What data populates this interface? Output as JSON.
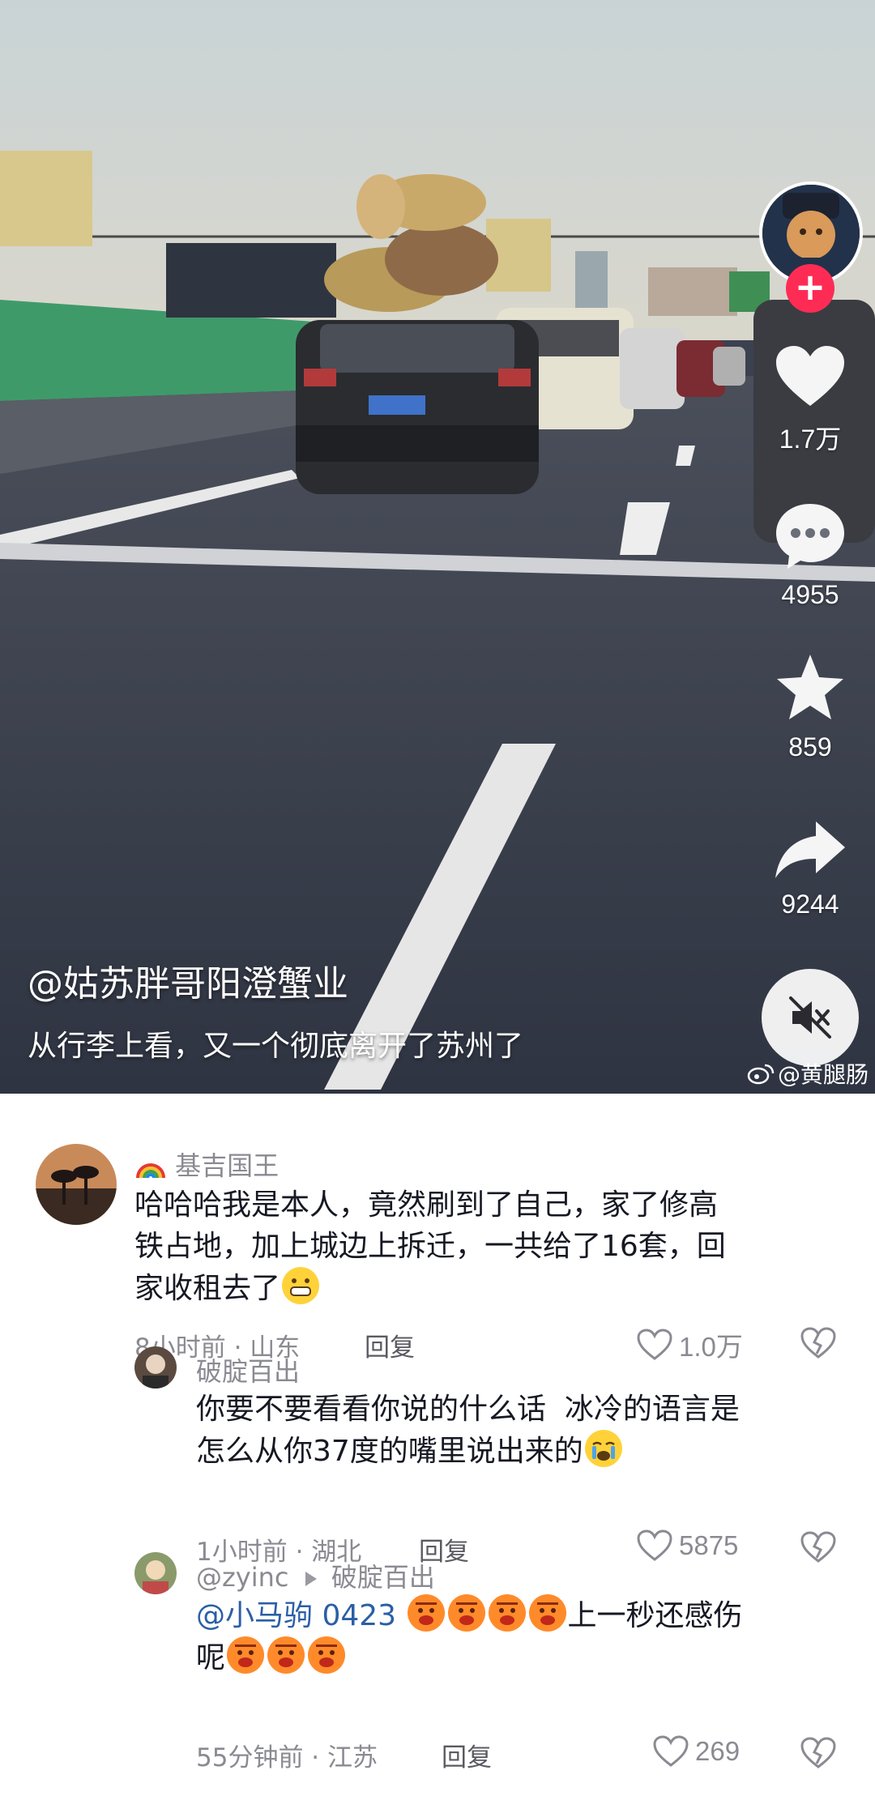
{
  "video": {
    "author_handle": "@姑苏胖哥阳澄蟹业",
    "caption": "从行李上看，又一个彻底离开了苏州了",
    "watermark": "@黄腿肠",
    "actions": {
      "like_count": "1.7万",
      "comment_count": "4955",
      "favorite_count": "859",
      "share_count": "9244"
    },
    "follow_label": "+"
  },
  "comments": [
    {
      "name": "基吉国王",
      "text": "哈哈哈我是本人，竟然刷到了自己，家了修高铁占地，加上城边上拆迁，一共给了16套，回家收租去了",
      "lines": [
        "哈哈哈我是本人，竟然刷到了自己，家了修高",
        "铁占地，加上城边上拆迁，一共给了16套，回",
        "家收租去了"
      ],
      "time_location": "8小时前 · 山东",
      "reply_label": "回复",
      "likes": "1.0万"
    },
    {
      "name": "破腚百出",
      "lines": [
        "你要不要看看你说的什么话  冰冷的语言是",
        "怎么从你37度的嘴里说出来的"
      ],
      "time_location": "1小时前 · 湖北",
      "reply_label": "回复",
      "likes": "5875"
    },
    {
      "name": "@zyinc",
      "reply_to": "破腚百出",
      "mention": "@小马驹 0423",
      "line1_tail": "上一秒还感伤",
      "line2_head": "呢",
      "time_location": "55分钟前 · 江苏",
      "reply_label": "回复",
      "likes": "269"
    }
  ],
  "colors": {
    "accent": "#fe2c55",
    "mention": "#2a5fa6",
    "meta_gray": "#8a8a92",
    "text": "#161823"
  }
}
